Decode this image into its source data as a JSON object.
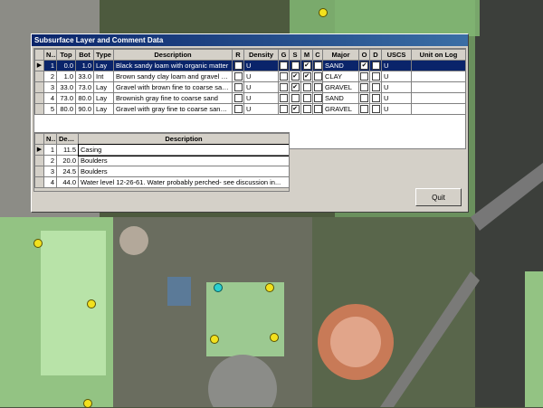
{
  "dialog": {
    "title": "Subsurface Layer and Comment Data",
    "quit_label": "Quit"
  },
  "layers": {
    "headers": [
      "No",
      "Top",
      "Bot",
      "Type",
      "Description",
      "R",
      "Density",
      "G",
      "S",
      "M",
      "C",
      "Major",
      "O",
      "D",
      "USCS",
      "Unit on Log"
    ],
    "rows": [
      {
        "no": "1",
        "top": "0.0",
        "bot": "1.0",
        "type": "Lay",
        "desc": "Black sandy loam with organic matter",
        "r": false,
        "density": "U",
        "g": false,
        "s": false,
        "m": true,
        "c": false,
        "major": "SAND",
        "o": true,
        "d": false,
        "uscs": "U",
        "unit": ""
      },
      {
        "no": "2",
        "top": "1.0",
        "bot": "33.0",
        "type": "Int",
        "desc": "Brown sandy clay loam and gravel gr...",
        "r": false,
        "density": "U",
        "g": false,
        "s": true,
        "m": true,
        "c": false,
        "major": "CLAY",
        "o": false,
        "d": false,
        "uscs": "U",
        "unit": ""
      },
      {
        "no": "3",
        "top": "33.0",
        "bot": "73.0",
        "type": "Lay",
        "desc": "Gravel with brown fine to coarse san...",
        "r": false,
        "density": "U",
        "g": false,
        "s": true,
        "m": false,
        "c": false,
        "major": "GRAVEL",
        "o": false,
        "d": false,
        "uscs": "U",
        "unit": ""
      },
      {
        "no": "4",
        "top": "73.0",
        "bot": "80.0",
        "type": "Lay",
        "desc": "Brownish gray fine to coarse sand",
        "r": false,
        "density": "U",
        "g": false,
        "s": false,
        "m": false,
        "c": false,
        "major": "SAND",
        "o": false,
        "d": false,
        "uscs": "U",
        "unit": ""
      },
      {
        "no": "5",
        "top": "80.0",
        "bot": "90.0",
        "type": "Lay",
        "desc": "Gravel with gray fine to coarse sand ...",
        "r": false,
        "density": "U",
        "g": false,
        "s": true,
        "m": false,
        "c": false,
        "major": "GRAVEL",
        "o": false,
        "d": false,
        "uscs": "U",
        "unit": ""
      }
    ]
  },
  "comments": {
    "headers": [
      "No",
      "Depth",
      "Description"
    ],
    "rows": [
      {
        "no": "1",
        "depth": "11.5",
        "desc": "Casing"
      },
      {
        "no": "2",
        "depth": "20.0",
        "desc": "Boulders"
      },
      {
        "no": "3",
        "depth": "24.5",
        "desc": "Boulders"
      },
      {
        "no": "4",
        "depth": "44.0",
        "desc": "Water level 12-26-61.  Water probably perched- see discussion in..."
      }
    ]
  },
  "colors": {
    "titlebar": "#0a246a",
    "selection": "#0a246a",
    "overlay_green": "#9ed98a",
    "marker": "#f2e11d"
  }
}
